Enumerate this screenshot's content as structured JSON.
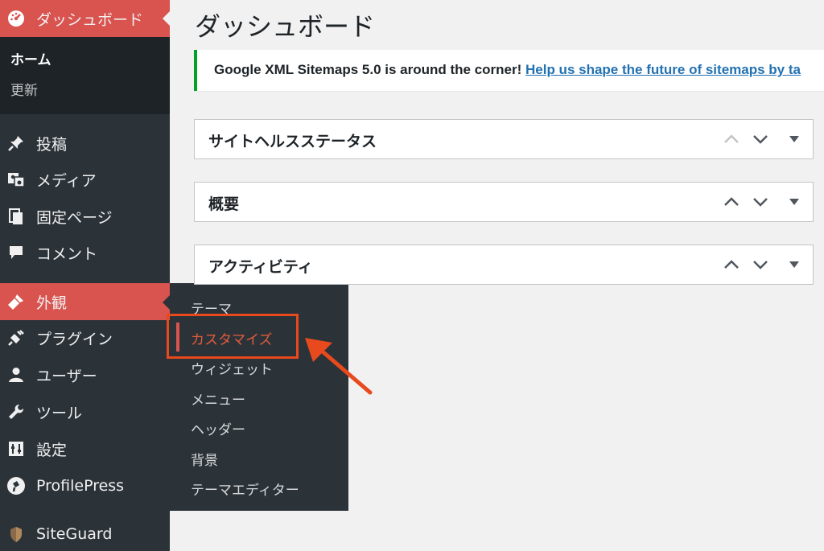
{
  "sidebar": {
    "dashboard_label": "ダッシュボード",
    "submenu": {
      "home": "ホーム",
      "update": "更新"
    },
    "items": [
      {
        "label": "投稿",
        "icon": "pin-icon"
      },
      {
        "label": "メディア",
        "icon": "media-icon"
      },
      {
        "label": "固定ページ",
        "icon": "pages-icon"
      },
      {
        "label": "コメント",
        "icon": "comment-icon"
      },
      {
        "label": "外観",
        "icon": "brush-icon"
      },
      {
        "label": "プラグイン",
        "icon": "plugin-icon"
      },
      {
        "label": "ユーザー",
        "icon": "user-icon"
      },
      {
        "label": "ツール",
        "icon": "wrench-icon"
      },
      {
        "label": "設定",
        "icon": "settings-icon"
      },
      {
        "label": "ProfilePress",
        "icon": "profilepress-icon"
      },
      {
        "label": "SiteGuard",
        "icon": "siteguard-icon"
      }
    ]
  },
  "flyout": {
    "items": [
      "テーマ",
      "カスタマイズ",
      "ウィジェット",
      "メニュー",
      "ヘッダー",
      "背景",
      "テーマエディター"
    ]
  },
  "main": {
    "title": "ダッシュボード",
    "notice": {
      "text": "Google XML Sitemaps 5.0 is around the corner! ",
      "link": "Help us shape the future of sitemaps by ta"
    },
    "postboxes": [
      {
        "title": "サイトヘルスステータス"
      },
      {
        "title": "概要"
      },
      {
        "title": "アクティビティ"
      }
    ]
  },
  "colors": {
    "sidebar_bg": "#2c3338",
    "active_bg": "#d9534f",
    "highlight": "#e8491d",
    "notice_border": "#00a32a",
    "link": "#2271b1"
  }
}
